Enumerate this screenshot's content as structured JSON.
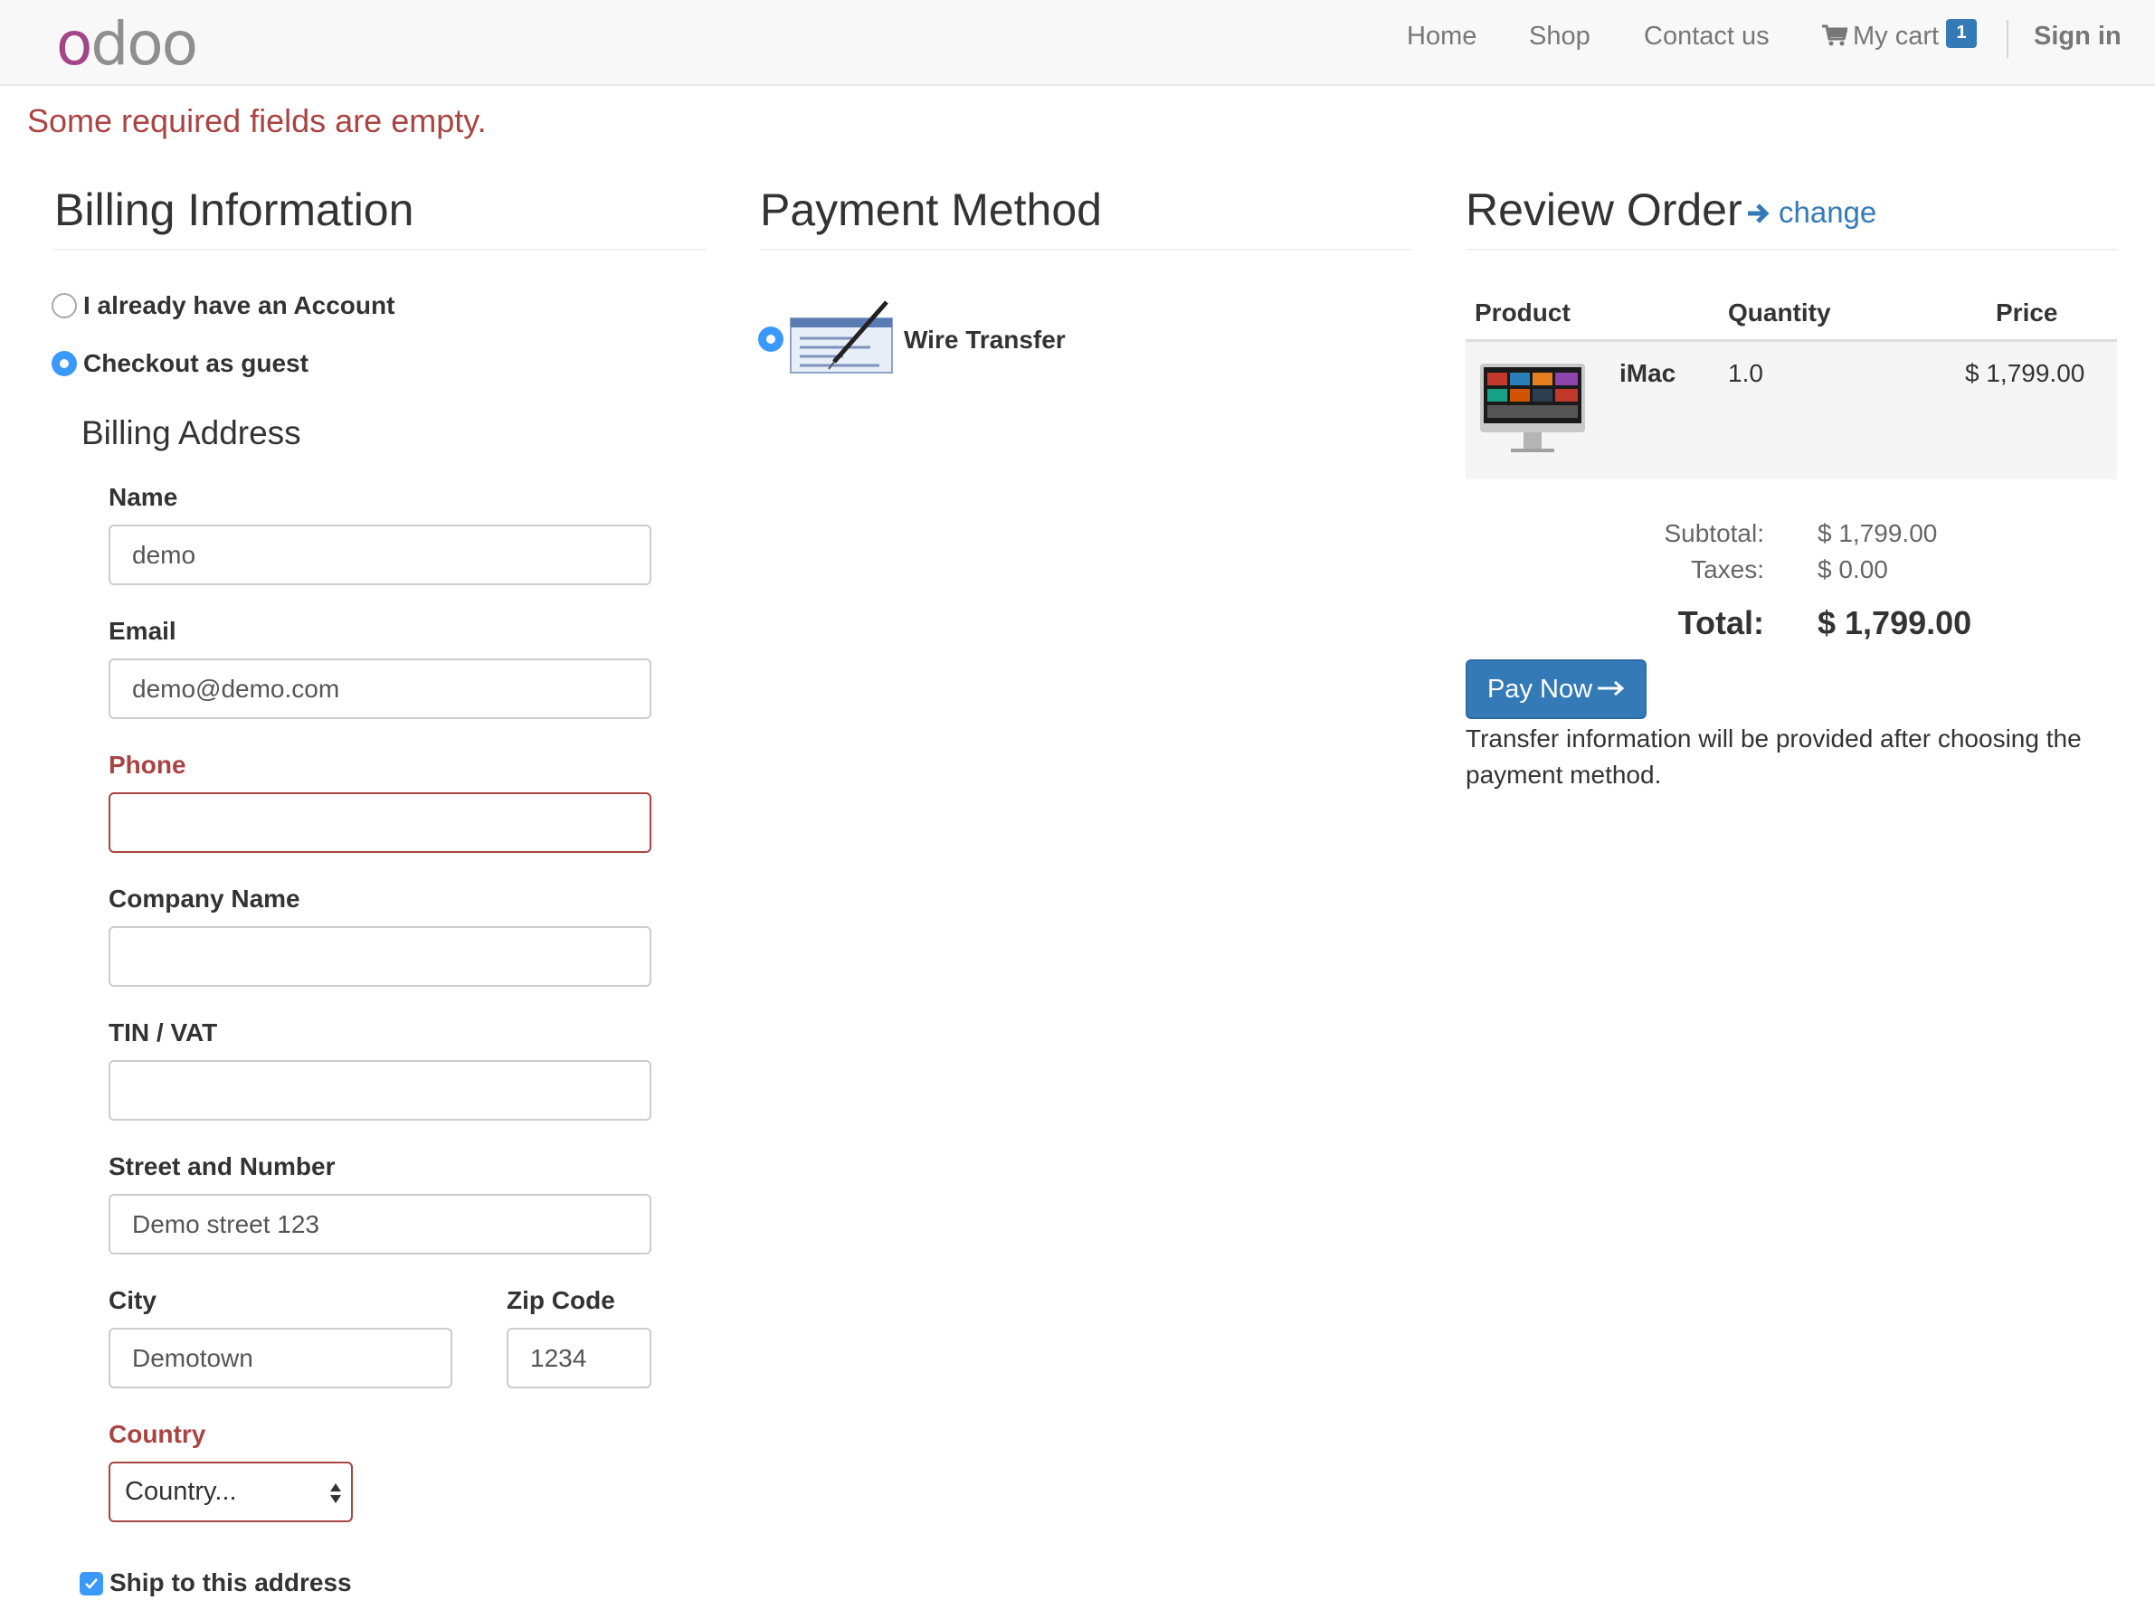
{
  "navbar": {
    "logo_first": "o",
    "logo_rest": "doo",
    "links": [
      "Home",
      "Shop",
      "Contact us"
    ],
    "cart_label": "My cart",
    "cart_count": "1",
    "signin_label": "Sign in"
  },
  "alert": {
    "message": "Some required fields are empty."
  },
  "billing": {
    "title": "Billing Information",
    "option_account": "I already have an Account",
    "option_guest": "Checkout as guest",
    "address_title": "Billing Address",
    "fields": {
      "name": {
        "label": "Name",
        "value": "demo"
      },
      "email": {
        "label": "Email",
        "value": "demo@demo.com"
      },
      "phone": {
        "label": "Phone",
        "value": ""
      },
      "company": {
        "label": "Company Name",
        "value": ""
      },
      "vat": {
        "label": "TIN / VAT",
        "value": ""
      },
      "street": {
        "label": "Street and Number",
        "value": "Demo street 123"
      },
      "city": {
        "label": "City",
        "value": "Demotown"
      },
      "zip": {
        "label": "Zip Code",
        "value": "1234"
      },
      "country": {
        "label": "Country",
        "value": "Country..."
      }
    },
    "ship_label": "Ship to this address"
  },
  "payment": {
    "title": "Payment Method",
    "method_label": "Wire Transfer"
  },
  "review": {
    "title": "Review Order",
    "change_label": "change",
    "columns": [
      "Product",
      "Quantity",
      "Price"
    ],
    "rows": [
      {
        "product": "iMac",
        "quantity": "1.0",
        "price": "$ 1,799.00"
      }
    ],
    "subtotal_label": "Subtotal:",
    "subtotal_value": "$ 1,799.00",
    "taxes_label": "Taxes:",
    "taxes_value": "$ 0.00",
    "total_label": "Total:",
    "total_value": "$ 1,799.00",
    "pay_label": "Pay Now",
    "info_text": "Transfer information will be provided after choosing the payment method."
  },
  "colors": {
    "accent": "#337ab7",
    "error": "#a94442",
    "radio": "#3b99fc",
    "logo": "#a24689"
  }
}
